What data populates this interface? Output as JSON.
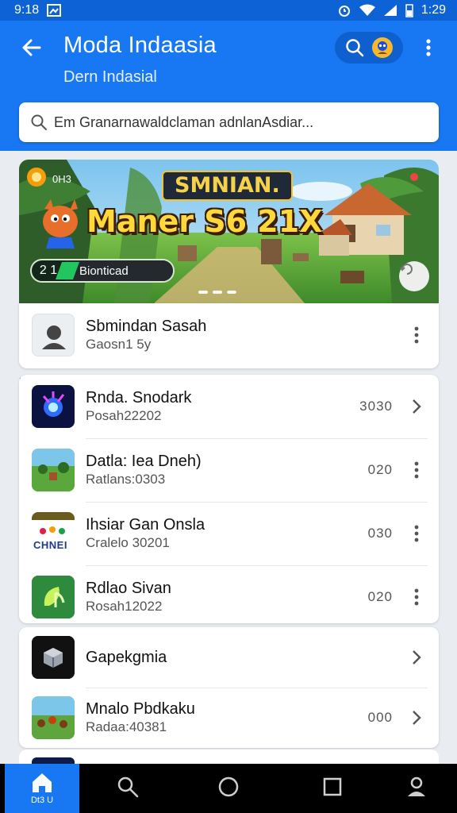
{
  "status_bar": {
    "time_left": "9:18",
    "time_right": "1:29"
  },
  "app_bar": {
    "title": "Moda Indaasia",
    "subtitle": "Dern Indasial"
  },
  "search": {
    "placeholder": "Em Granarnawaldclaman adnlanAsdiar..."
  },
  "banner": {
    "tag": "SMNIAN.",
    "title": "Maner S6 21X",
    "small_label": "0H3",
    "badge_number": "2 1",
    "badge_label": "Bionticad"
  },
  "featured_item": {
    "title": "Sbmindan Sasah",
    "subtitle": "Gaosn1 5y",
    "icon": "person-icon"
  },
  "list_items": [
    {
      "title": "Rnda. Snodark",
      "subtitle": "Posah22202",
      "value": "3030",
      "action": "chevron-right-icon"
    },
    {
      "title": "Datla: Iea Dneh)",
      "subtitle": "Ratlans:0303",
      "value": "020",
      "action": "more-vert-icon"
    },
    {
      "title": "Ihsiar Gan Onsla",
      "subtitle": "Cralelo 30201",
      "value": "030",
      "action": "more-vert-icon",
      "icon_text": "CHNEI"
    },
    {
      "title": "Rdlao Sivan",
      "subtitle": "Rosah12022",
      "value": "020",
      "action": "more-vert-icon"
    }
  ],
  "bottom_items": [
    {
      "title": "Gapekgmia",
      "subtitle": "",
      "value": "",
      "action": "chevron-right-icon"
    },
    {
      "title": "Mnalo Pbdkaku",
      "subtitle": "Radaa:40381",
      "value": "000",
      "action": "chevron-right-icon"
    }
  ],
  "nav": {
    "home_label": "Dt3 U"
  },
  "colors": {
    "primary": "#1877f2",
    "status_bar": "#0d62d6",
    "background": "#e9edf2"
  }
}
